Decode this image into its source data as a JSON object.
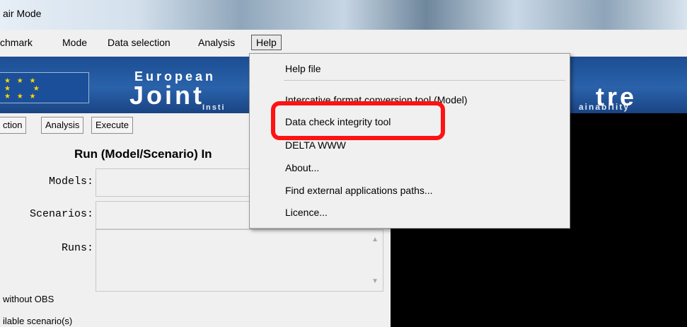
{
  "window": {
    "title": "air Mode"
  },
  "menubar": {
    "items": [
      "chmark",
      "Mode",
      "Data selection",
      "Analysis",
      "Help"
    ],
    "open": "Help"
  },
  "banner": {
    "line1": "European",
    "line2": "Joint",
    "line3": "Insti",
    "right1": "tre",
    "right2": "ainability"
  },
  "tabs": [
    "ction",
    "Analysis",
    "Execute"
  ],
  "panel": {
    "title": "Run (Model/Scenario) In",
    "fields": [
      {
        "label": "Models:"
      },
      {
        "label": "Scenarios:"
      },
      {
        "label": "Runs:"
      }
    ],
    "text1": "without OBS",
    "text2": "ilable scenario(s)"
  },
  "help_menu": {
    "items": [
      "Help file",
      "Intercative format conversion tool (Model)",
      "Data check integrity tool",
      "DELTA WWW",
      "About...",
      "Find external applications paths...",
      "Licence..."
    ]
  },
  "colors": {
    "highlight": "#ff1212",
    "banner": "#2a62ab"
  }
}
